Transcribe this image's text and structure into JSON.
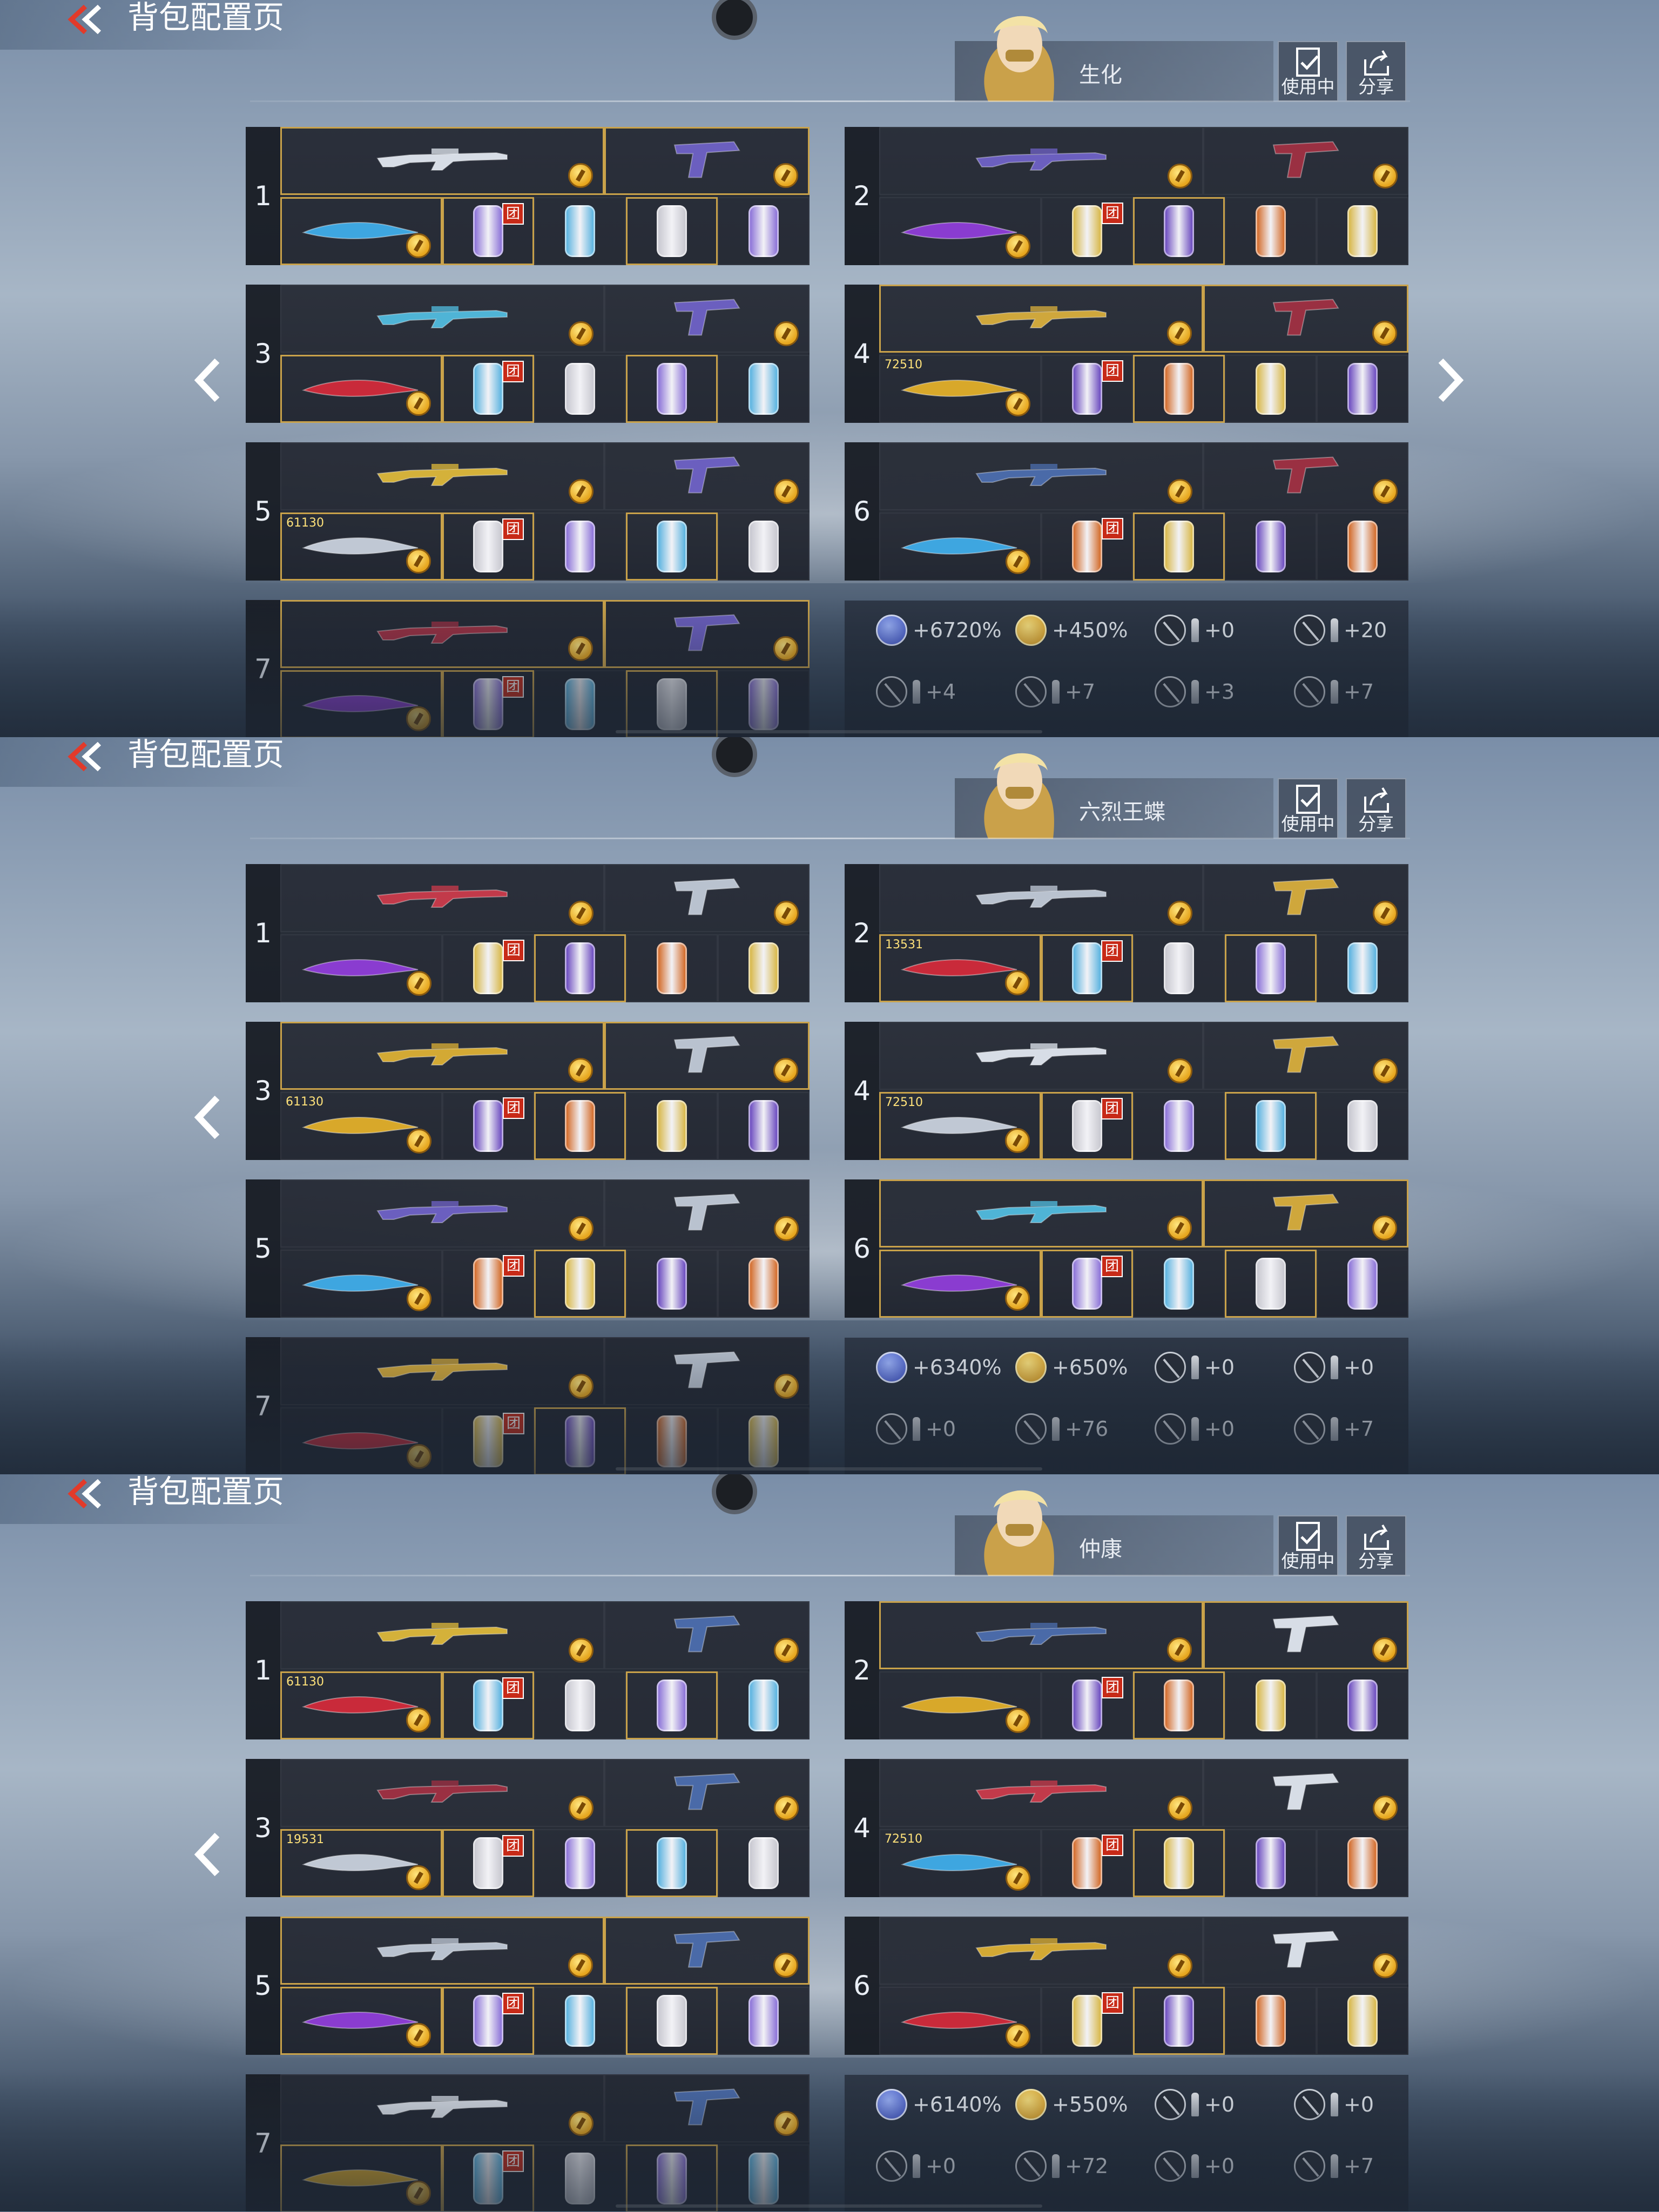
{
  "screens": [
    {
      "page_title": "背包配置页",
      "bag_name": "生化",
      "in_use_label": "使用中",
      "share_label": "分享",
      "show_right_arrow": true,
      "slots": [
        {
          "num": "1",
          "badge": "",
          "team_tag": "团"
        },
        {
          "num": "2",
          "badge": "",
          "team_tag": "团"
        },
        {
          "num": "3",
          "badge": "",
          "team_tag": "团"
        },
        {
          "num": "4",
          "badge": "72510",
          "team_tag": "团"
        },
        {
          "num": "5",
          "badge": "61130",
          "team_tag": "团"
        },
        {
          "num": "6",
          "badge": "",
          "team_tag": "团"
        },
        {
          "num": "7",
          "badge": "",
          "team_tag": "团"
        }
      ],
      "bonuses": [
        "+6720%",
        "+450%",
        "+0",
        "+20",
        "+4",
        "+7",
        "+3",
        "+7"
      ]
    },
    {
      "page_title": "背包配置页",
      "bag_name": "六烈王蝶",
      "in_use_label": "使用中",
      "share_label": "分享",
      "show_right_arrow": false,
      "slots": [
        {
          "num": "1",
          "badge": "",
          "team_tag": "团"
        },
        {
          "num": "2",
          "badge": "13531",
          "team_tag": "团"
        },
        {
          "num": "3",
          "badge": "61130",
          "team_tag": "团"
        },
        {
          "num": "4",
          "badge": "72510",
          "team_tag": "团"
        },
        {
          "num": "5",
          "badge": "",
          "team_tag": "团"
        },
        {
          "num": "6",
          "badge": "",
          "team_tag": "团"
        },
        {
          "num": "7",
          "badge": "",
          "team_tag": "团"
        }
      ],
      "bonuses": [
        "+6340%",
        "+650%",
        "+0",
        "+0",
        "+0",
        "+76",
        "+0",
        "+7"
      ]
    },
    {
      "page_title": "背包配置页",
      "bag_name": "仲康",
      "in_use_label": "使用中",
      "share_label": "分享",
      "show_right_arrow": false,
      "slots": [
        {
          "num": "1",
          "badge": "61130",
          "team_tag": "团"
        },
        {
          "num": "2",
          "badge": "",
          "team_tag": "团"
        },
        {
          "num": "3",
          "badge": "19531",
          "team_tag": "团"
        },
        {
          "num": "4",
          "badge": "72510",
          "team_tag": "团"
        },
        {
          "num": "5",
          "badge": "",
          "team_tag": "团"
        },
        {
          "num": "6",
          "badge": "",
          "team_tag": "团"
        },
        {
          "num": "7",
          "badge": "",
          "team_tag": "团"
        }
      ],
      "bonuses": [
        "+6140%",
        "+550%",
        "+0",
        "+0",
        "+0",
        "+72",
        "+0",
        "+7"
      ]
    }
  ],
  "bonus_icons": [
    "exp-icon",
    "gold-coin-icon",
    "knife-ammo-icon",
    "rifle-ammo-icon",
    "knife-ammo-icon",
    "rifle-ammo-icon",
    "knife-ammo-icon",
    "pistol-ammo-icon"
  ],
  "colors": {
    "gold_border": "#c9a24a",
    "coin": "#e6a51d",
    "team_tag": "#c72a18"
  }
}
